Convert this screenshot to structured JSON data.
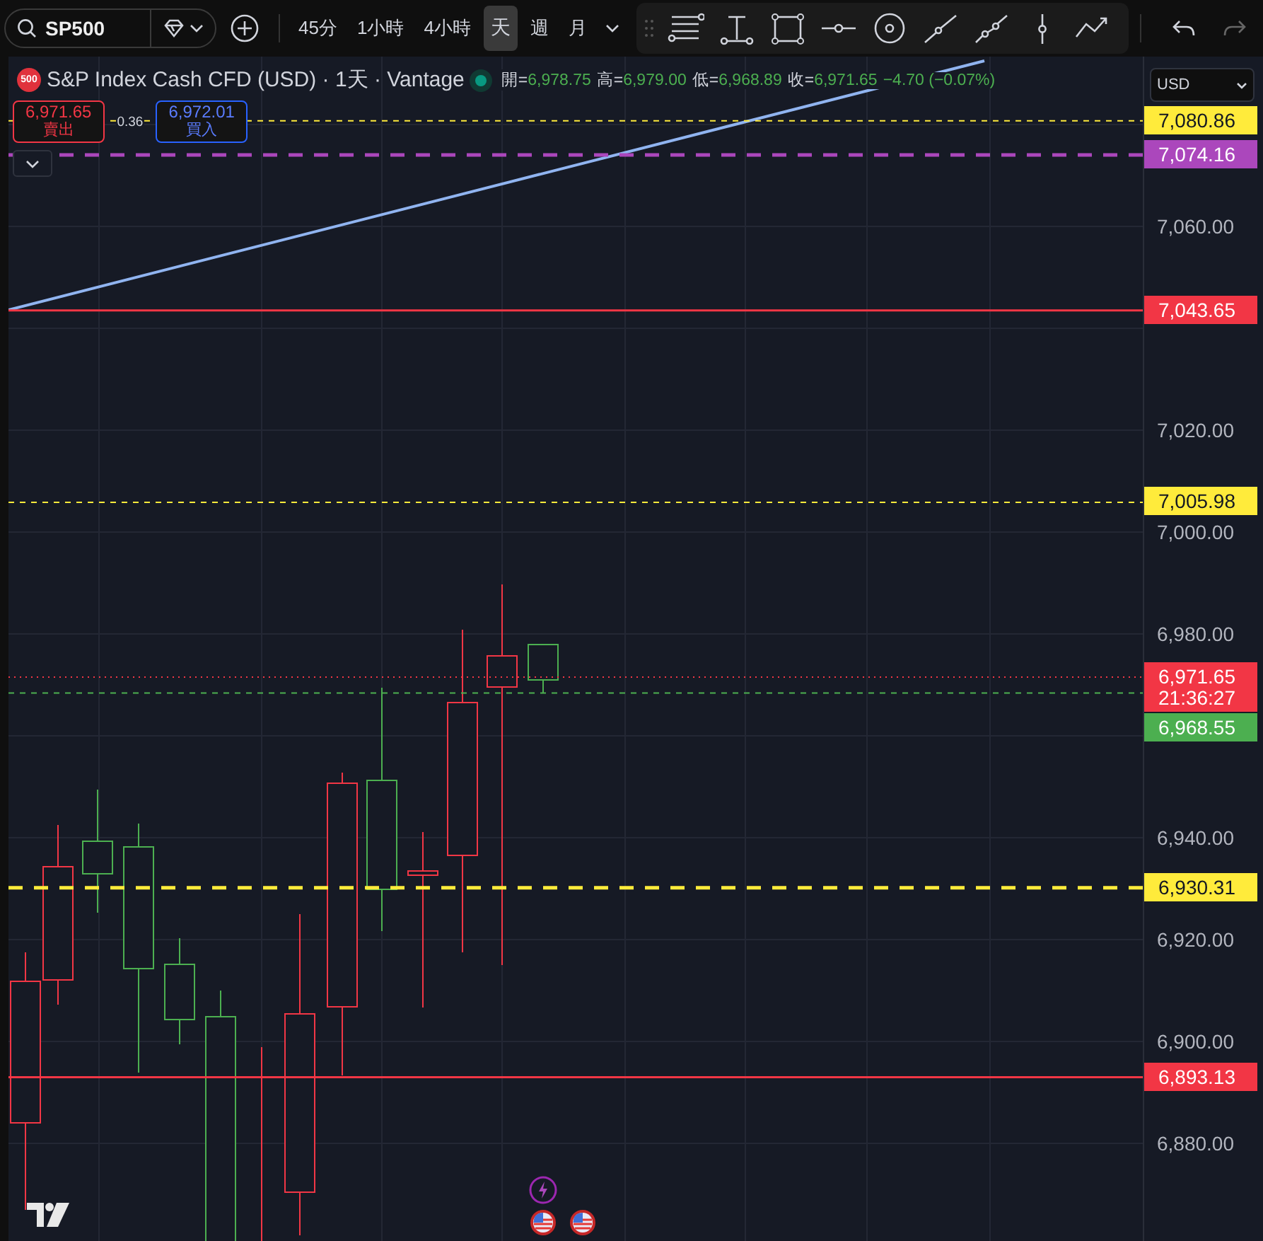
{
  "toolbar": {
    "symbol": "SP500",
    "intervals": [
      {
        "label": "45分",
        "selected": false
      },
      {
        "label": "1小時",
        "selected": false
      },
      {
        "label": "4小時",
        "selected": false
      },
      {
        "label": "天",
        "selected": true
      },
      {
        "label": "週",
        "selected": false
      },
      {
        "label": "月",
        "selected": false
      }
    ]
  },
  "legend": {
    "badge": "500",
    "title": "S&P Index Cash CFD (USD) · 1天 · Vantage",
    "ohlc": [
      {
        "label": "開=",
        "value": "6,978.75"
      },
      {
        "label": "高=",
        "value": "6,979.00"
      },
      {
        "label": "低=",
        "value": "6,968.89"
      },
      {
        "label": "收=",
        "value": "6,971.65"
      }
    ],
    "change": "−4.70 (−0.07%)"
  },
  "trade": {
    "sell_price": "6,971.65",
    "sell_label": "賣出",
    "spread": "0.36",
    "buy_price": "6,972.01",
    "buy_label": "買入"
  },
  "price_axis": {
    "currency": "USD",
    "ticks": [
      "7,060.00",
      "7,020.00",
      "7,000.00",
      "6,980.00",
      "6,940.00",
      "6,920.00",
      "6,900.00",
      "6,880.00"
    ]
  },
  "price_lines": [
    {
      "price": "7,080.86",
      "color": "#ffeb3b",
      "kind": "dash"
    },
    {
      "price": "7,074.16",
      "color": "#ab47bc",
      "kind": "longdash"
    },
    {
      "price": "7,043.65",
      "color": "#f23645",
      "kind": "solid"
    },
    {
      "price": "7,005.98",
      "color": "#ffeb3b",
      "kind": "dash"
    },
    {
      "price": "6,971.65",
      "time": "21:36:27",
      "color": "#f23645",
      "kind": "dot"
    },
    {
      "price": "6,968.55",
      "color": "#4caf50",
      "kind": "dash"
    },
    {
      "price": "6,930.31",
      "color": "#ffeb3b",
      "kind": "longdash"
    },
    {
      "price": "6,893.13",
      "color": "#f23645",
      "kind": "solid"
    }
  ]
}
